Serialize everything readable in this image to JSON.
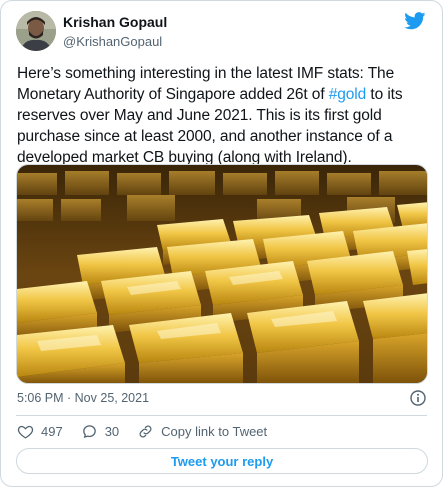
{
  "author": {
    "display_name": "Krishan Gopaul",
    "handle": "@KrishanGopaul"
  },
  "tweet": {
    "text_part1": "Here’s something interesting in the latest IMF stats: The Monetary Authority of Singapore added 26t of ",
    "hashtag": "#gold",
    "text_part2": " to its reserves over May and June 2021. This is its first gold purchase since at least 2000, and another instance of a developed market CB buying (along with Ireland).",
    "timestamp": "5:06 PM · Nov 25, 2021"
  },
  "media": {
    "icon": "gold-bars-photo"
  },
  "actions": {
    "likes": "497",
    "replies": "30",
    "copy_link": "Copy link to Tweet"
  },
  "reply_button": "Tweet your reply",
  "colors": {
    "accent": "#1d9bf0",
    "text": "#0f1419",
    "secondary": "#536471",
    "border": "#cfd9de"
  }
}
